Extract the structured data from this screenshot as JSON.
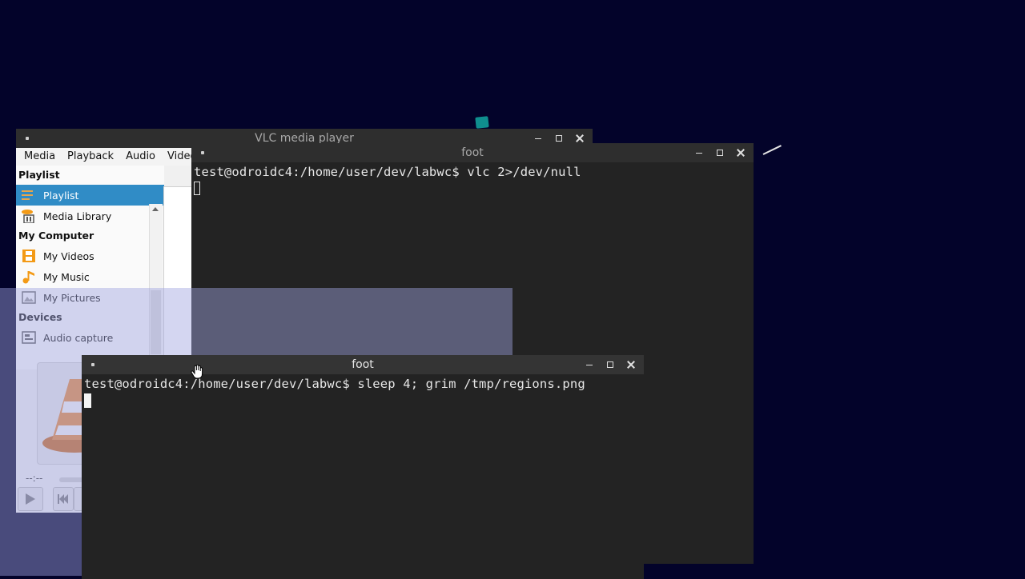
{
  "desktop": {
    "background": "#03032a"
  },
  "vlc": {
    "title": "VLC media player",
    "menu": [
      "Media",
      "Playback",
      "Audio",
      "Video"
    ],
    "sidebar": {
      "sections": [
        {
          "header": "Playlist",
          "items": [
            {
              "label": "Playlist",
              "icon": "playlist-icon",
              "selected": true
            },
            {
              "label": "Media Library",
              "icon": "media-library-icon",
              "selected": false
            }
          ]
        },
        {
          "header": "My Computer",
          "items": [
            {
              "label": "My Videos",
              "icon": "film-icon"
            },
            {
              "label": "My Music",
              "icon": "music-note-icon"
            },
            {
              "label": "My Pictures",
              "icon": "picture-icon"
            }
          ]
        },
        {
          "header": "Devices",
          "items": [
            {
              "label": "Audio capture",
              "icon": "capture-card-icon"
            }
          ]
        }
      ]
    },
    "time": "--:--",
    "accent": "#308cc6"
  },
  "terminals": [
    {
      "title": "foot",
      "prompt": "test@odroidc4:/home/user/dev/labwc$ vlc 2>/dev/null"
    },
    {
      "title": "foot",
      "prompt": "test@odroidc4:/home/user/dev/labwc$ sleep 4; grim /tmp/regions.png"
    }
  ]
}
